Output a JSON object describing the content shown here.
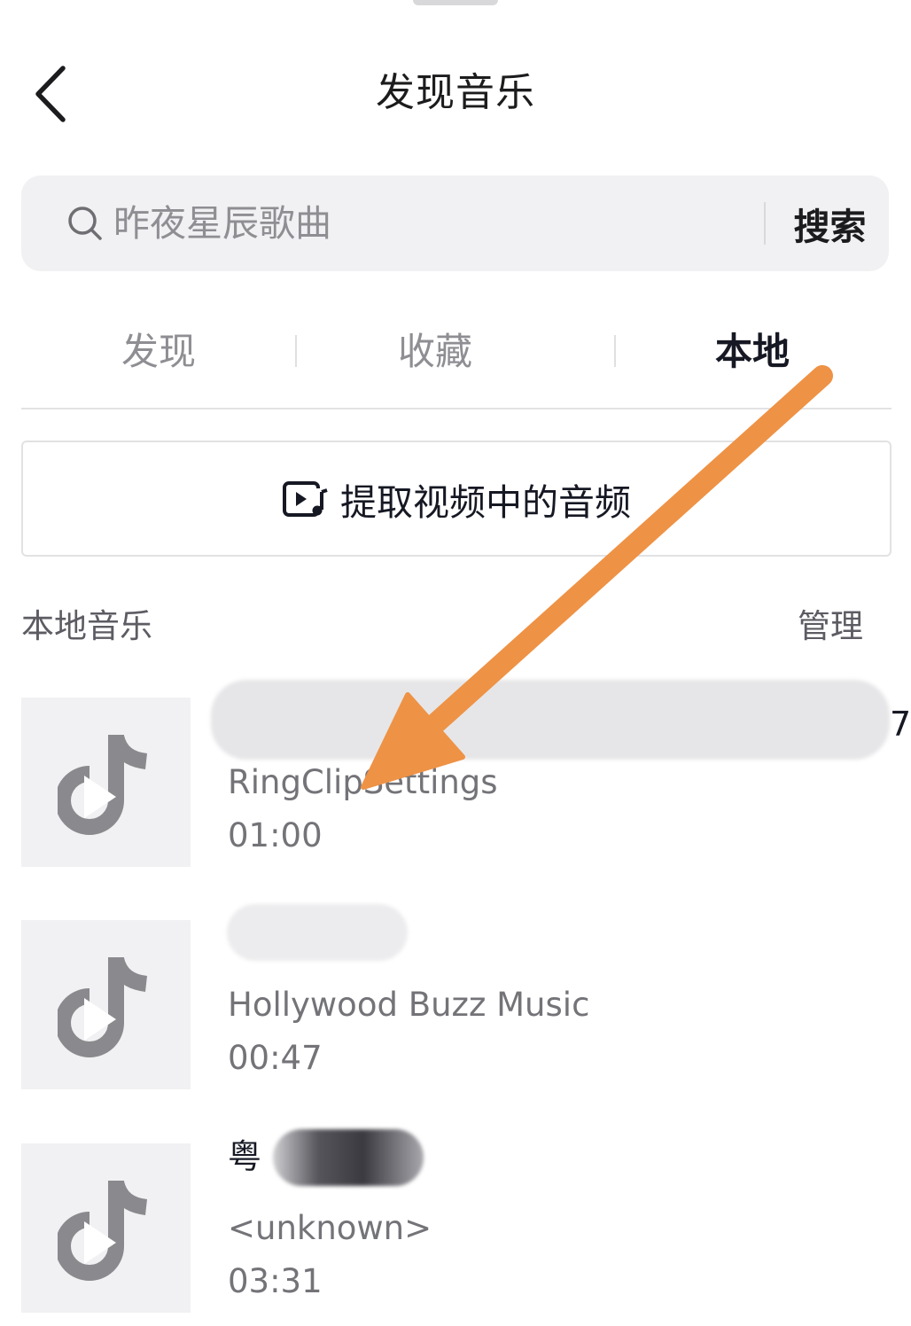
{
  "header": {
    "title": "发现音乐",
    "back_icon": "chevron-left-icon"
  },
  "search": {
    "placeholder": "昨夜星辰歌曲",
    "button_label": "搜索",
    "icon": "search-icon"
  },
  "tabs": [
    {
      "label": "发现",
      "active": false
    },
    {
      "label": "收藏",
      "active": false
    },
    {
      "label": "本地",
      "active": true
    }
  ],
  "extract": {
    "label": "提取视频中的音频",
    "icon": "video-music-icon"
  },
  "local_section": {
    "title": "本地音乐",
    "manage_label": "管理"
  },
  "tracks": [
    {
      "title": "7",
      "artist": "RingClipSettings",
      "duration": "01:00",
      "cover_icon": "tiktok-logo-icon"
    },
    {
      "title": "",
      "artist": "Hollywood Buzz Music",
      "duration": "00:47",
      "cover_icon": "tiktok-logo-icon"
    },
    {
      "title": "粤",
      "artist": "<unknown>",
      "duration": "03:31",
      "cover_icon": "tiktok-logo-icon"
    }
  ],
  "annotation": {
    "arrow_color": "#ee9245"
  },
  "colors": {
    "active_tab": "#161823",
    "inactive_tab": "#8e8e93",
    "search_bg": "#f1f1f3",
    "cover_bg": "#f1f1f3"
  }
}
